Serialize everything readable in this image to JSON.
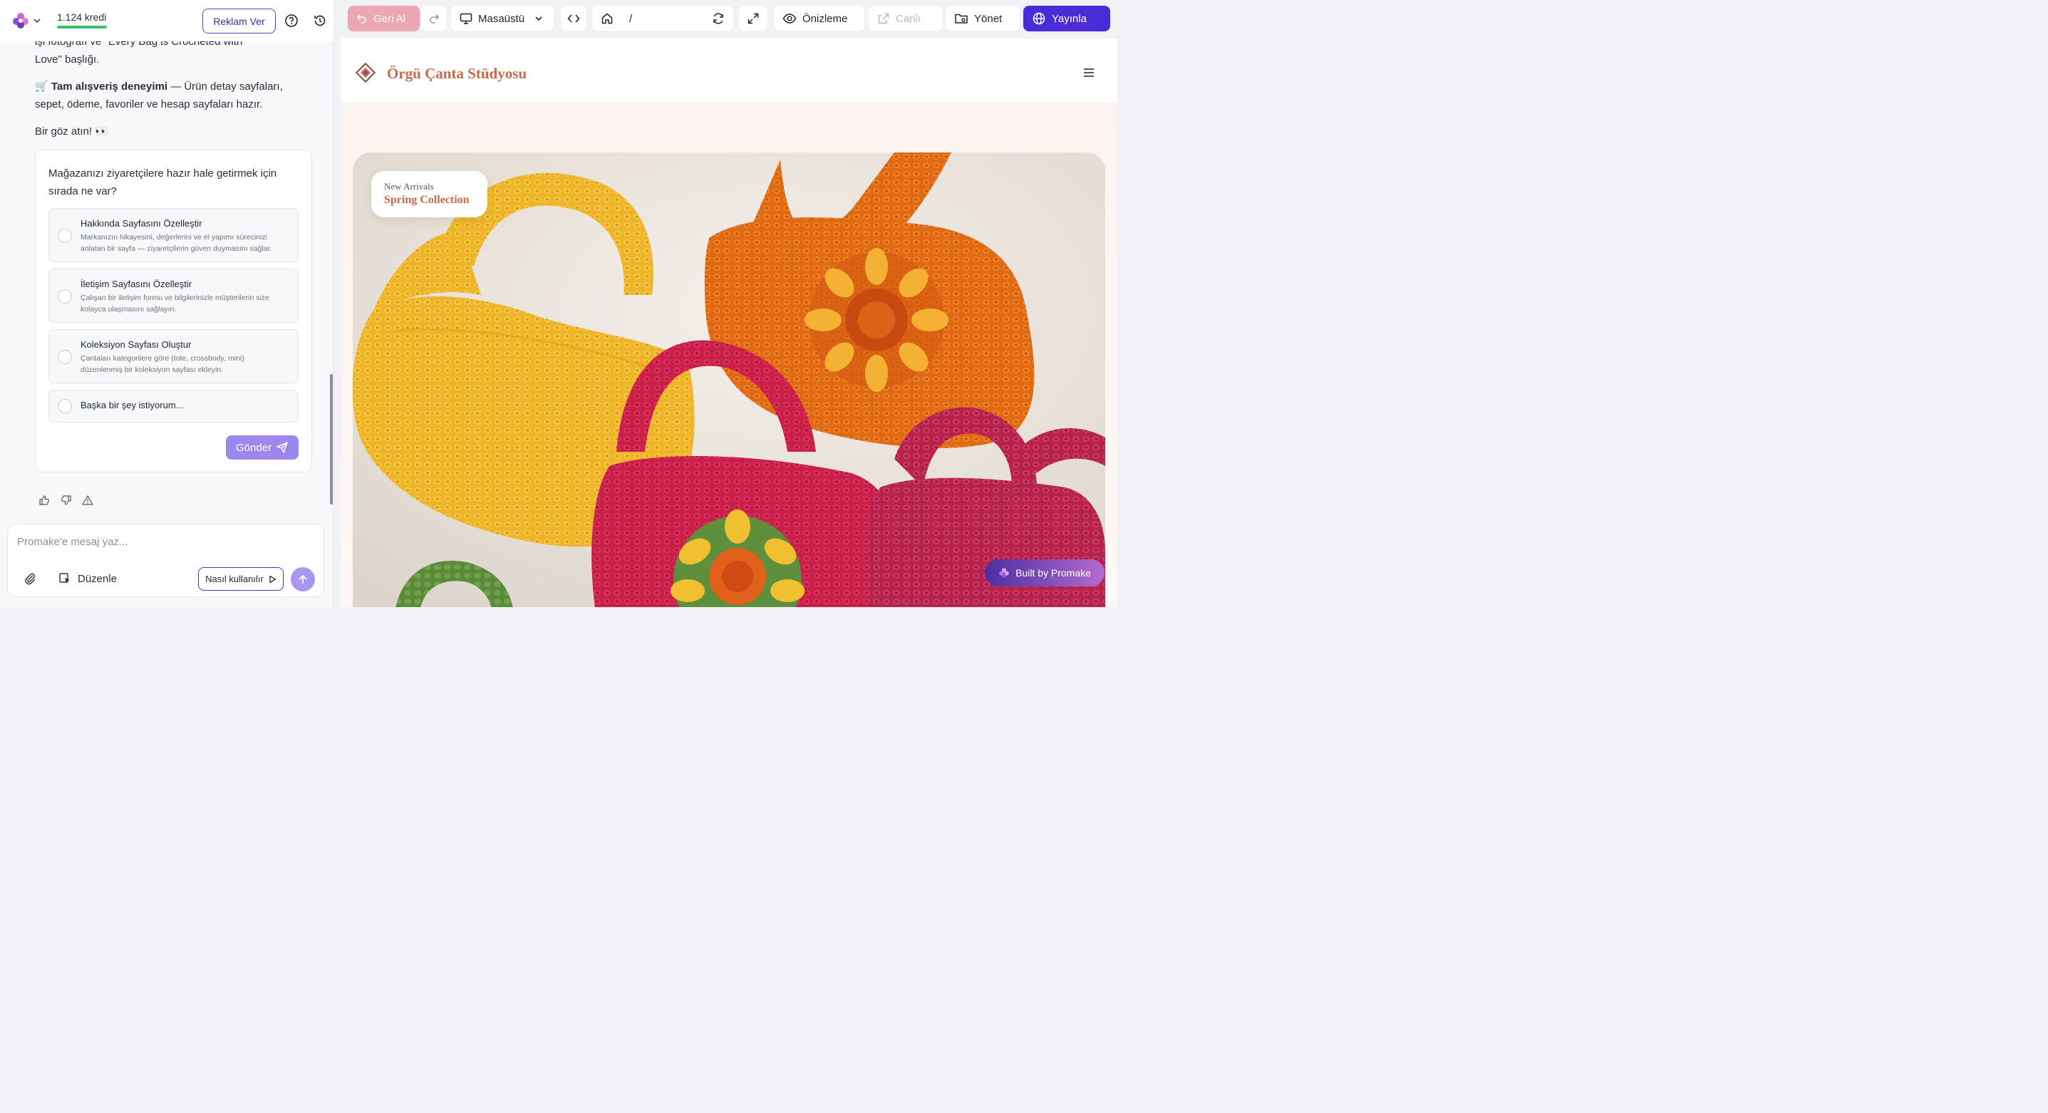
{
  "app": {
    "credits": "1.124 kredi",
    "ad_button": "Reklam Ver"
  },
  "chat": {
    "partial_line_1": "işi fotoğrafı ve \"Every Bag is Crocheted with",
    "partial_line_2": "Love\" başlığı.",
    "shopping_title": "Tam alışveriş deneyimi",
    "shopping_text": "— Ürün detay sayfaları, sepet, ödeme, favoriler ve hesap sayfaları hazır.",
    "look_text": "Bir göz atın! 👀",
    "question": "Mağazanızı ziyaretçilere hazır hale getirmek için sırada ne var?",
    "options": [
      {
        "title": "Hakkında Sayfasını Özelleştir",
        "desc": "Markanızın hikayesini, değerlerini ve el yapımı sürecinizi anlatan bir sayfa — ziyaretçilerin güven duymasını sağlar."
      },
      {
        "title": "İletişim Sayfasını Özelleştir",
        "desc": "Çalışan bir iletişim formu ve bilgilerinizle müşterilerin size kolayca ulaşmasını sağlayın."
      },
      {
        "title": "Koleksiyon Sayfası Oluştur",
        "desc": "Çantaları kategorilere göre (tote, crossbody, mini) düzenlenmiş bir koleksiyon sayfası ekleyin."
      },
      {
        "title": "Başka bir şey istiyorum...",
        "desc": ""
      }
    ],
    "send_label": "Gönder"
  },
  "composer": {
    "placeholder": "Promake'e mesaj yaz...",
    "edit_label": "Düzenle",
    "how_label": "Nasıl kullanılır"
  },
  "toolbar": {
    "undo": "Geri Al",
    "device": "Masaüstü",
    "path": "/",
    "preview": "Önizleme",
    "live": "Canlı",
    "manage": "Yönet",
    "publish": "Yayınla"
  },
  "site": {
    "title": "Örgü Çanta Stüdyosu",
    "badge_small": "New Arrivals",
    "badge_main": "Spring Collection",
    "built_by": "Built by Promake"
  },
  "colors": {
    "accent": "#4a2bd8",
    "brand_site": "#c66a4a",
    "credit_bar": "#3cbf6a"
  }
}
